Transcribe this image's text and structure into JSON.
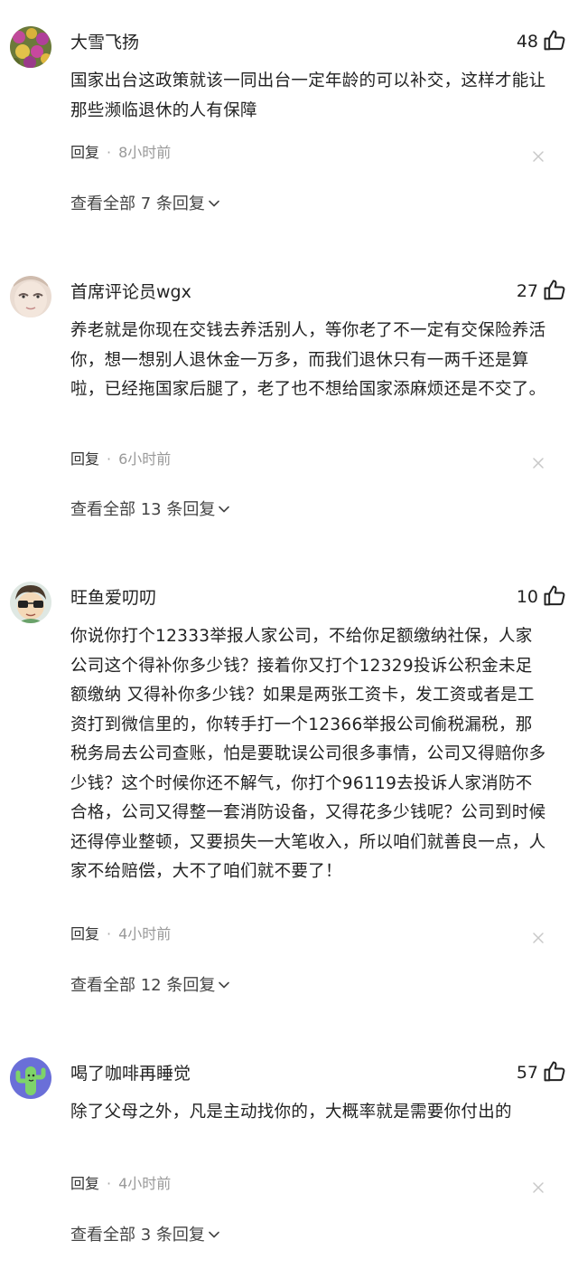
{
  "ui": {
    "reply_label": "回复",
    "dot": "·"
  },
  "comments": [
    {
      "avatar_icon": "flowers-avatar-icon",
      "username": "大雪飞扬",
      "likes": "48",
      "text": "国家出台这政策就该一同出台一定年龄的可以补交，这样才能让那些濒临退休的人有保障",
      "time": "8小时前",
      "replies_text": "查看全部 7 条回复"
    },
    {
      "avatar_icon": "face-avatar-icon",
      "username": "首席评论员wgx",
      "likes": "27",
      "text": "养老就是你现在交钱去养活别人，等你老了不一定有交保险养活你，想一想别人退休金一万多，而我们退休只有一两千还是算啦，已经拖国家后腿了，老了也不想给国家添麻烦还是不交了。",
      "time": "6小时前",
      "replies_text": "查看全部 13 条回复"
    },
    {
      "avatar_icon": "cartoon-glasses-avatar-icon",
      "username": "旺鱼爱叨叨",
      "likes": "10",
      "text": "你说你打个12333举报人家公司，不给你足额缴纳社保，人家公司这个得补你多少钱？接着你又打个12329投诉公积金未足额缴纳 又得补你多少钱？如果是两张工资卡，发工资或者是工资打到微信里的，你转手打一个12366举报公司偷税漏税，那税务局去公司查账，怕是要耽误公司很多事情，公司又得赔你多少钱？这个时候你还不解气，你打个96119去投诉人家消防不合格，公司又得整一套消防设备，又得花多少钱呢？公司到时候还得停业整顿，又要损失一大笔收入，所以咱们就善良一点，人家不给赔偿，大不了咱们就不要了！",
      "time": "4小时前",
      "replies_text": "查看全部 12 条回复"
    },
    {
      "avatar_icon": "cactus-avatar-icon",
      "username": "喝了咖啡再睡觉",
      "likes": "57",
      "text": "除了父母之外，凡是主动找你的，大概率就是需要你付出的",
      "time": "4小时前",
      "replies_text": "查看全部 3 条回复"
    }
  ]
}
